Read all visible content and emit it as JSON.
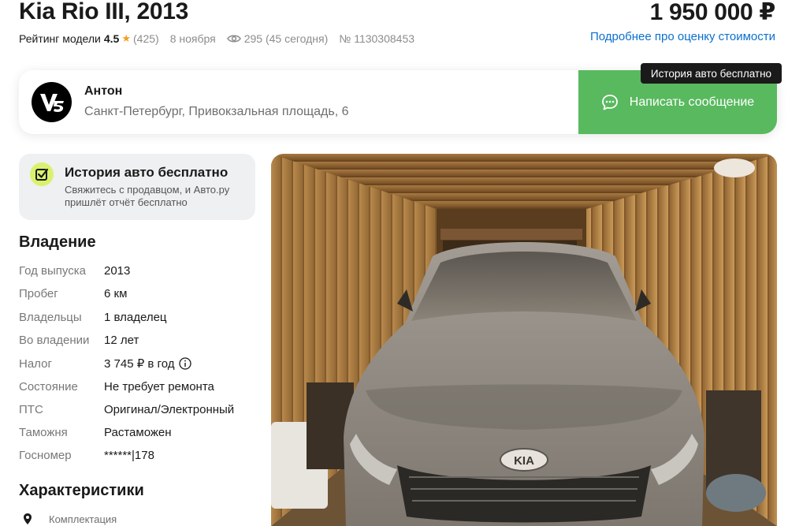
{
  "listing": {
    "title": "Kia Rio III, 2013",
    "price": "1 950 000 ₽",
    "rating_label": "Рейтинг модели",
    "rating_value": "4.5",
    "rating_count": "(425)",
    "date": "8 ноября",
    "views": "295 (45 сегодня)",
    "listing_number": "№ 1130308453",
    "estimate_link": "Подробнее про оценку стоимости"
  },
  "seller": {
    "name": "Антон",
    "address": "Санкт-Петербург, Привокзальная площадь, 6",
    "message_button": "Написать сообщение"
  },
  "tooltip": "История авто бесплатно",
  "history_card": {
    "title": "История авто бесплатно",
    "text": "Свяжитесь с продавцом, и Авто.ру пришлёт отчёт бесплатно"
  },
  "ownership": {
    "title": "Владение",
    "rows": [
      {
        "label": "Год выпуска",
        "value": "2013"
      },
      {
        "label": "Пробег",
        "value": "6 км"
      },
      {
        "label": "Владельцы",
        "value": "1 владелец"
      },
      {
        "label": "Во владении",
        "value": "12 лет"
      },
      {
        "label": "Налог",
        "value": "3 745 ₽ в год"
      },
      {
        "label": "Состояние",
        "value": "Не требует ремонта"
      },
      {
        "label": "ПТС",
        "value": "Оригинал/Электронный"
      },
      {
        "label": "Таможня",
        "value": "Растаможен"
      },
      {
        "label": "Госномер",
        "value": "******|178"
      }
    ]
  },
  "characteristics": {
    "title": "Характеристики",
    "first_item": "Комплектация"
  },
  "photo": {
    "badge_text": "KIA"
  },
  "colors": {
    "accent_green": "#59b95f",
    "link_blue": "#0b6fcf",
    "star": "#f2a01e",
    "history_icon_bg": "#d9f26e"
  },
  "icons": [
    "star-icon",
    "eye-icon",
    "seller-logo",
    "chat-icon",
    "history-check-icon",
    "info-icon",
    "pin-icon"
  ]
}
